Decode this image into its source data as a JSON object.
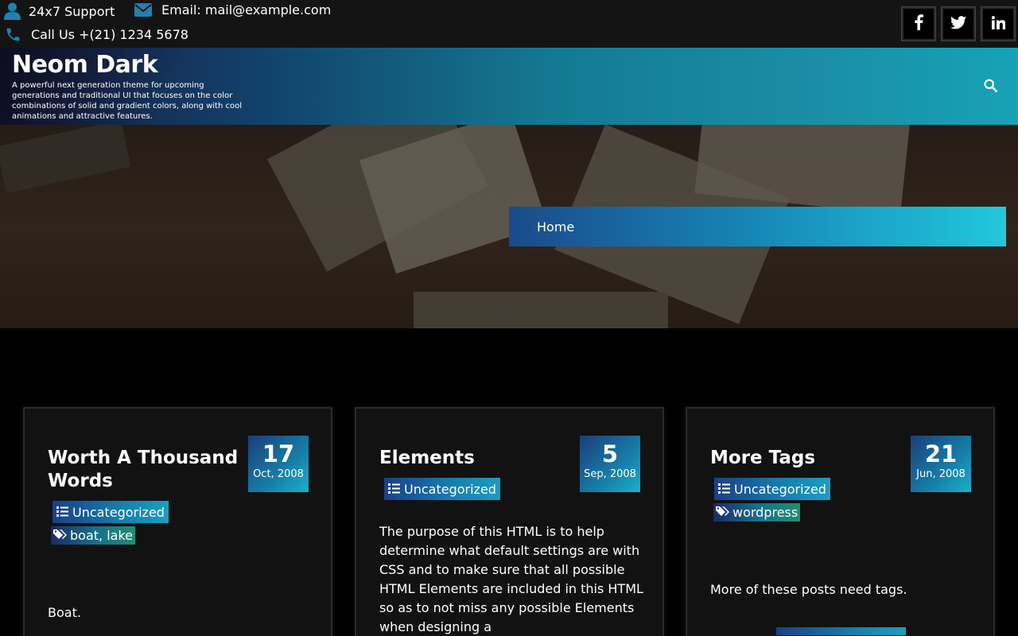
{
  "topbar": {
    "support": "24x7 Support",
    "email": "Email: mail@example.com",
    "call": "Call Us +(21) 1234 5678",
    "social": [
      {
        "name": "facebook",
        "icon": "facebook-icon"
      },
      {
        "name": "twitter",
        "icon": "twitter-icon"
      },
      {
        "name": "linkedin",
        "icon": "linkedin-icon"
      }
    ]
  },
  "header": {
    "site_title": "Neom Dark",
    "site_description": "A powerful next generation theme for upcoming generations and traditional UI that focuses on the color combinations of solid and gradient colors, along with cool animations and attractive features.",
    "search_icon": "search-icon"
  },
  "hero": {
    "breadcrumb": "Home"
  },
  "colors": {
    "accent_blue": "#157fb0",
    "accent_cyan": "#22c8dc",
    "background": "#000000",
    "card_background": "#121212"
  },
  "posts": [
    {
      "title": "Worth A Thousand Words",
      "day": "17",
      "month_year": "Oct, 2008",
      "category": "Uncategorized",
      "tags": "boat, lake",
      "excerpt": "Boat."
    },
    {
      "title": "Elements",
      "day": "5",
      "month_year": "Sep, 2008",
      "category": "Uncategorized",
      "tags": "",
      "excerpt": "The purpose of this HTML is to help determine what default settings are with CSS and to make sure that all possible HTML Elements are included in this HTML so as to not miss any possible Elements when designing a"
    },
    {
      "title": "More Tags",
      "day": "21",
      "month_year": "Jun, 2008",
      "category": "Uncategorized",
      "tags": "wordpress",
      "excerpt": "More of these posts need tags."
    }
  ]
}
